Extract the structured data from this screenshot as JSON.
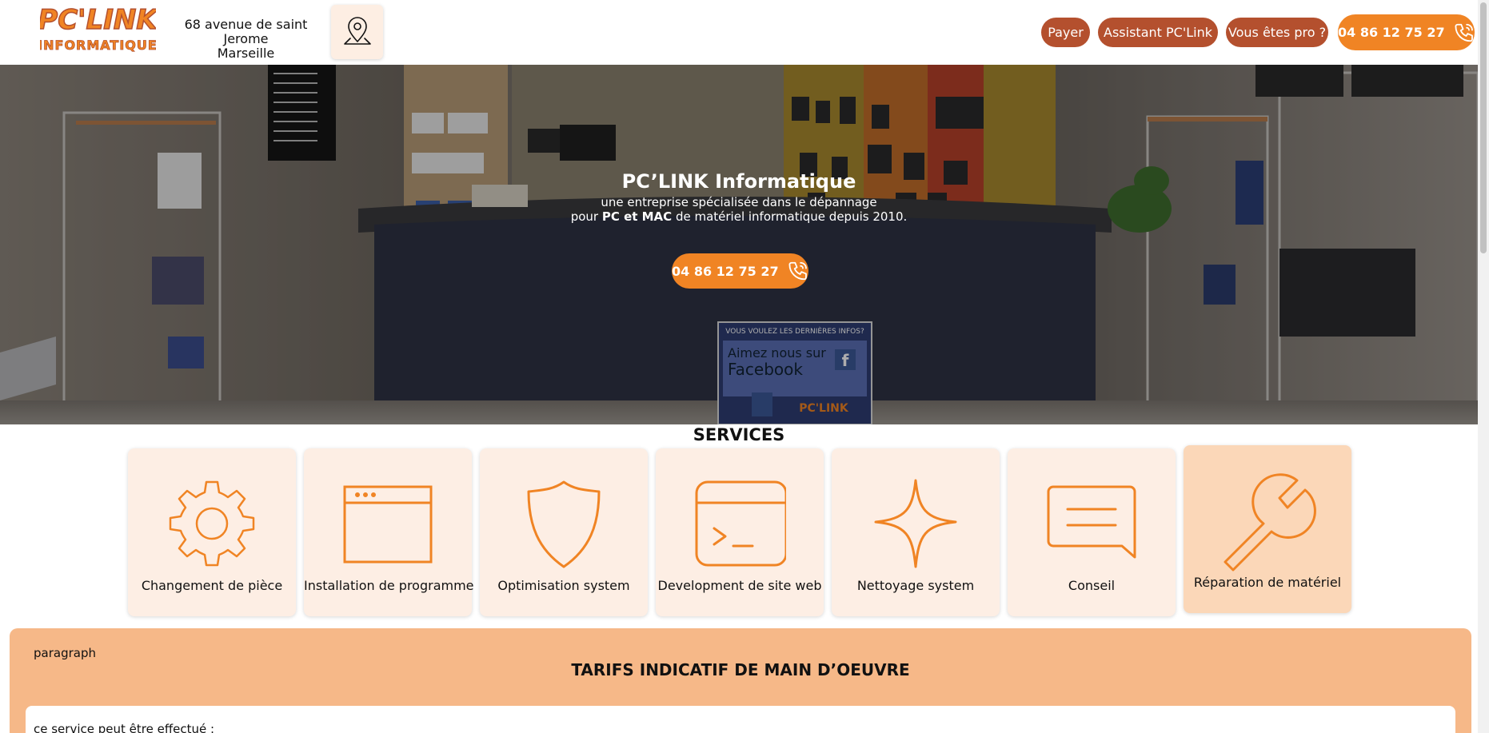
{
  "header": {
    "logo_line1": "PC'LINK",
    "logo_line2": "INFORMATIQUE",
    "address_line1": "68 avenue de saint Jerome",
    "address_line2": "Marseille",
    "nav": {
      "payer": "Payer",
      "assistant": "Assistant PC'Link",
      "pro": "Vous êtes pro ?"
    },
    "phone": "04 86 12 75 27"
  },
  "hero": {
    "title": "PC’LINK Informatique",
    "subtitle_line1": "une entreprise spécialisée dans le dépannage",
    "subtitle_pre": "pour ",
    "subtitle_bold": "PC et MAC",
    "subtitle_post": " de matériel informatique depuis 2010.",
    "phone": "04 86 12 75 27",
    "poster_line1": "VOUS VOULEZ LES DERNIÈRES INFOS?",
    "poster_line2": "Aimez nous sur",
    "poster_line3": "Facebook"
  },
  "services": {
    "title": "SERVICES",
    "items": [
      {
        "label": "Changement de pièce",
        "icon": "gear-icon"
      },
      {
        "label": "Installation de programme",
        "icon": "browser-window-icon"
      },
      {
        "label": "Optimisation system",
        "icon": "shield-icon"
      },
      {
        "label": "Development de site web",
        "icon": "terminal-icon"
      },
      {
        "label": "Nettoyage system",
        "icon": "sparkle-icon"
      },
      {
        "label": "Conseil",
        "icon": "message-icon"
      },
      {
        "label": "Réparation de matériel",
        "icon": "wrench-icon",
        "active": true
      }
    ]
  },
  "tarifs": {
    "paragraph_label": "paragraph",
    "title": "TARIFS INDICATIF DE MAIN D’OEUVRE",
    "text": "ce service peut être effectué :"
  },
  "colors": {
    "accent": "#f08424",
    "nav_pill": "#b4502e",
    "card_bg": "#fdeee4",
    "card_active_bg": "#fbd7b8",
    "tarifs_bg": "#f6b888"
  }
}
